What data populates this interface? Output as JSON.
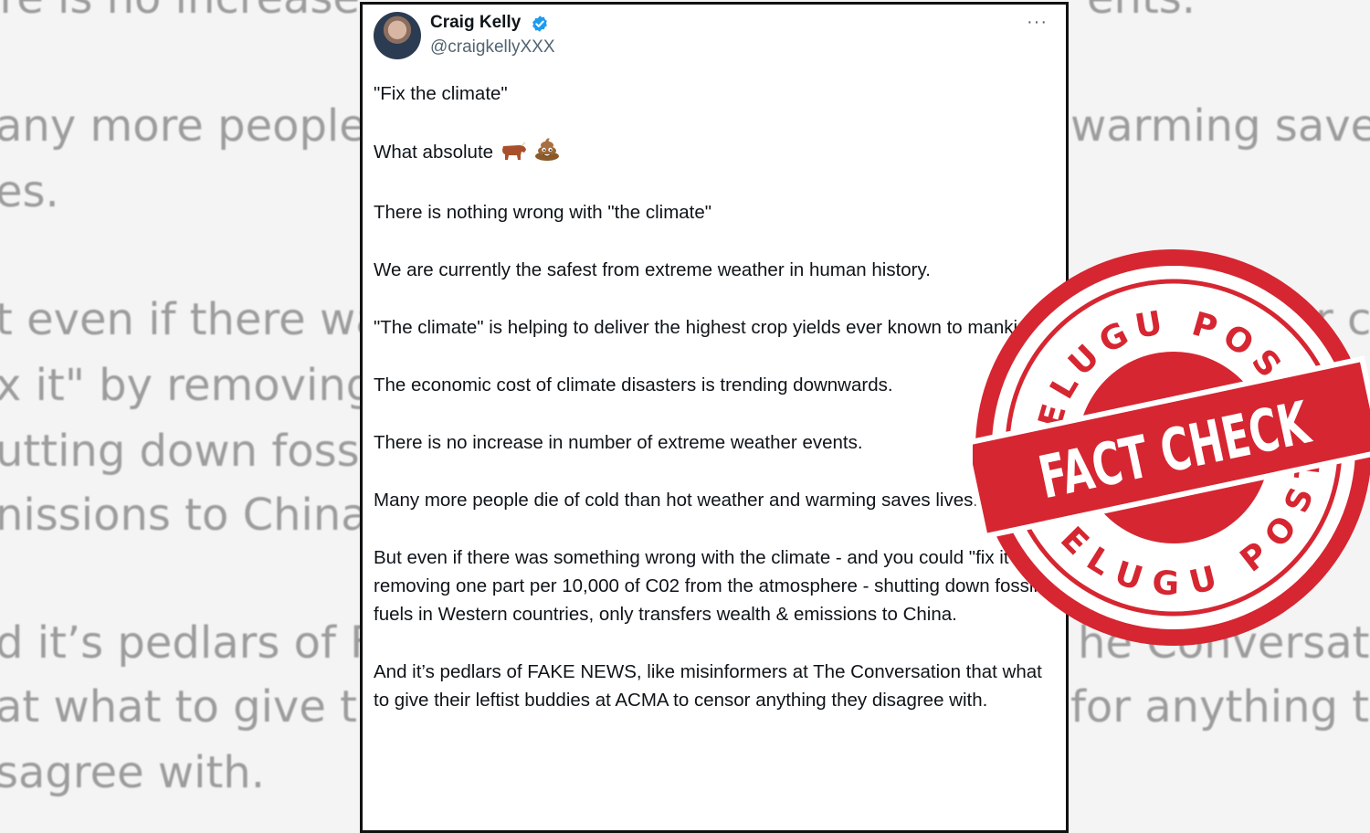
{
  "background": {
    "lines": [
      "ere is no increase",
      "ents.",
      "any more people c",
      "warming saves",
      "es.",
      "t even if there wa",
      "x  it\"  by removing",
      "utting down fossi",
      "nissions to China.",
      "d it’s pedlars of F",
      "he Conversatio",
      "at what to give the",
      "for anything the",
      "sagree with.",
      "r co",
      "ere"
    ]
  },
  "tweet": {
    "author_name": "Craig Kelly",
    "handle": "@craigkellyXXX",
    "more_label": "···",
    "paragraphs": [
      "\"Fix the climate\"",
      "What absolute",
      "There is nothing wrong with \"the climate\"",
      "We are currently the safest from extreme weather in human history.",
      "\"The climate\" is helping to deliver the highest crop yields ever known to mankind.",
      "The economic cost of climate disasters is trending downwards.",
      "There is no increase in number of extreme weather events.",
      "Many more people die of cold than  hot weather and warming saves lives.",
      "But even if there was something wrong with the climate  -  and you could \"fix  it\"  by removing one part  per 10,000 of C02 from the atmosphere - shutting down fossil fuels in Western countries, only transfers wealth & emissions to China.",
      "And it’s pedlars of FAKE NEWS, like misinformers at The Conversation that what to give their leftist buddies at ACMA to censor anything they disagree with."
    ],
    "emoji_icons": [
      "bull-emoji-icon",
      "poop-emoji-icon"
    ]
  },
  "stamp": {
    "top_text": "TELUGU POST",
    "main_text": "FACT CHECK",
    "bottom_text": "TELUGU POST",
    "color": "#d62631"
  },
  "colors": {
    "verified": "#1d9bf0",
    "text": "#0f1419",
    "muted": "#536471"
  }
}
